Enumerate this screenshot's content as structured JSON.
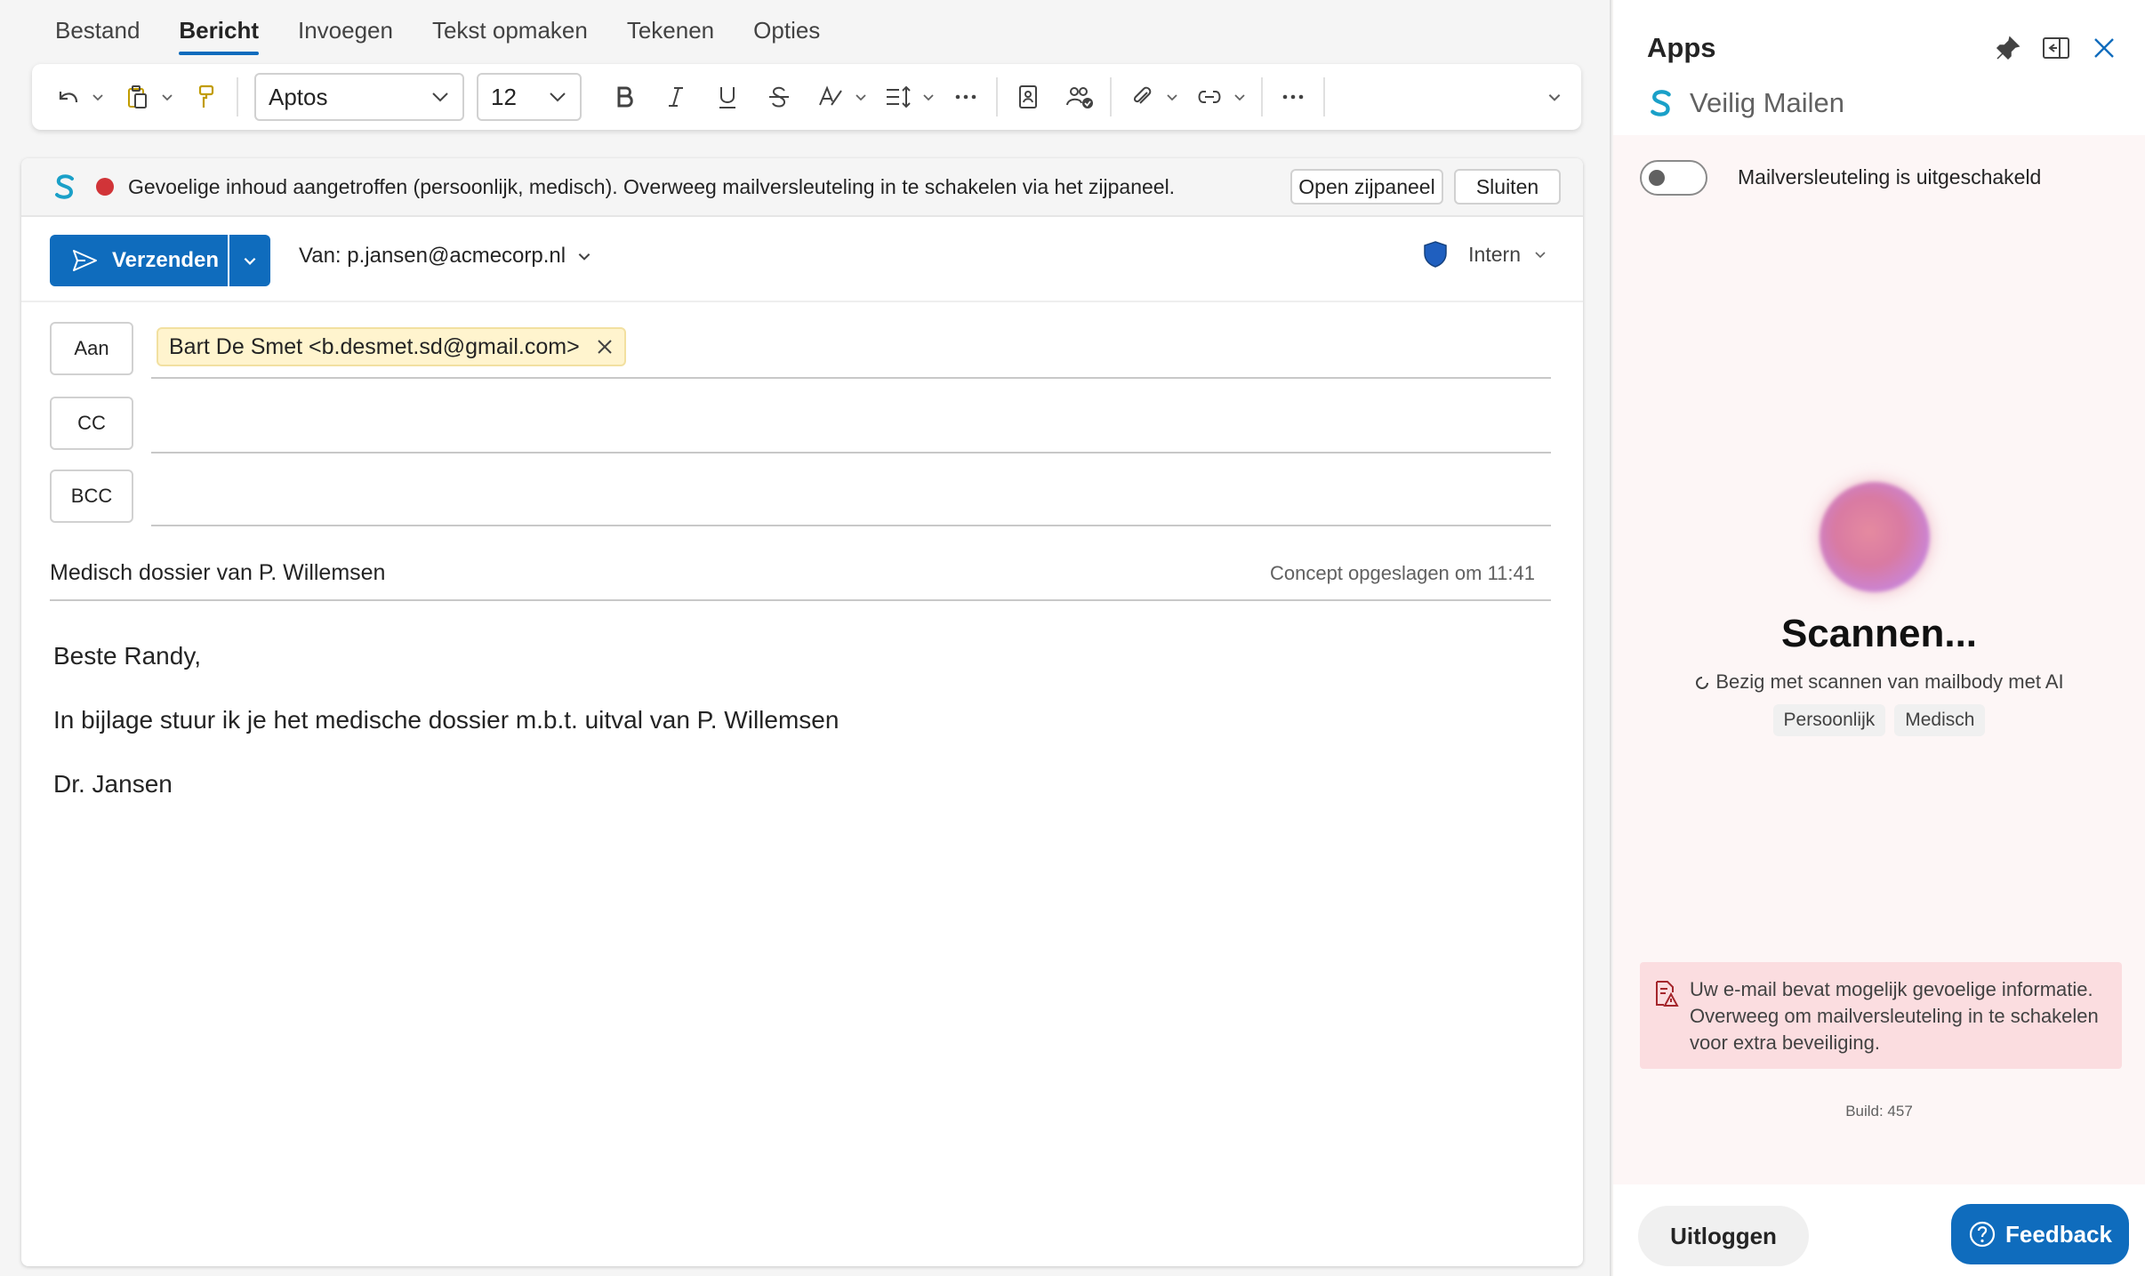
{
  "menu": {
    "tabs": [
      "Bestand",
      "Bericht",
      "Invoegen",
      "Tekst opmaken",
      "Tekenen",
      "Opties"
    ],
    "active": "Bericht"
  },
  "ribbon": {
    "font": "Aptos",
    "size": "12"
  },
  "infobar": {
    "message": "Gevoelige inhoud aangetroffen (persoonlijk, medisch). Overweeg mailversleuteling in te schakelen via het zijpaneel.",
    "open_label": "Open zijpaneel",
    "close_label": "Sluiten"
  },
  "compose": {
    "send_label": "Verzenden",
    "from": "Van: p.jansen@acmecorp.nl",
    "sensitivity": "Intern",
    "to_label": "Aan",
    "cc_label": "CC",
    "bcc_label": "BCC",
    "recipient": "Bart De Smet <b.desmet.sd@gmail.com>",
    "subject": "Medisch dossier van P. Willemsen",
    "draft_status": "Concept opgeslagen om 11:41",
    "body": {
      "greeting": "Beste Randy,",
      "line": "In bijlage stuur ik je het medische dossier m.b.t. uitval van P. Willemsen",
      "signature": "Dr. Jansen"
    }
  },
  "sidepanel": {
    "title": "Apps",
    "addin_name": "Veilig Mailen",
    "toggle_label": "Mailversleuteling is uitgeschakeld",
    "scan_title": "Scannen...",
    "scan_sub": "Bezig met scannen van mailbody met AI",
    "tags": [
      "Persoonlijk",
      "Medisch"
    ],
    "warning": "Uw e-mail bevat mogelijk gevoelige informatie. Overweeg om mailversleuteling in te schakelen voor extra beveiliging.",
    "build": "Build: 457",
    "logout_label": "Uitloggen",
    "feedback_label": "Feedback"
  },
  "colors": {
    "accent": "#0f6cbd",
    "alert": "#d13438",
    "brand": "#1aa0c8"
  }
}
